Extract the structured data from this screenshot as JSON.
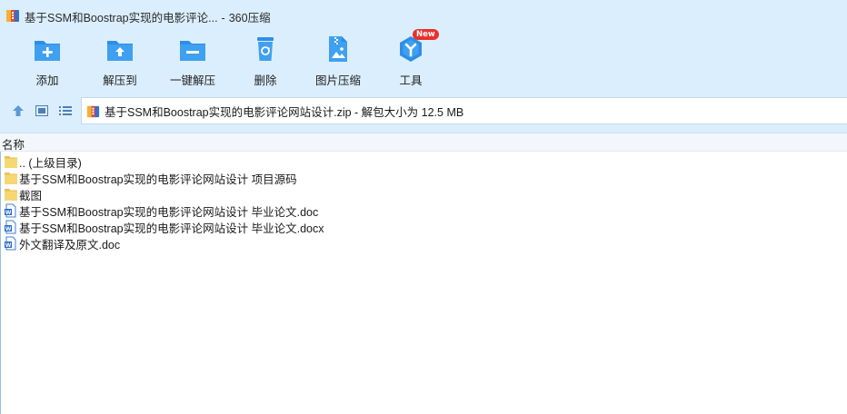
{
  "window": {
    "title": "基于SSM和Boostrap实现的电影评论...",
    "separator": "-",
    "app_name": "360压缩"
  },
  "toolbar": {
    "items": [
      {
        "label": "添加",
        "icon": "add-icon"
      },
      {
        "label": "解压到",
        "icon": "extract-to-icon"
      },
      {
        "label": "一键解压",
        "icon": "one-click-extract-icon"
      },
      {
        "label": "删除",
        "icon": "delete-icon"
      },
      {
        "label": "图片压缩",
        "icon": "image-compress-icon"
      },
      {
        "label": "工具",
        "icon": "tools-icon",
        "badge": "New"
      }
    ]
  },
  "nav": {
    "up_icon": "arrow-up-icon",
    "thumbnail_view_icon": "thumbnail-view-icon",
    "list_view_icon": "list-view-icon",
    "path_text": "基于SSM和Boostrap实现的电影评论网站设计.zip - 解包大小为 12.5 MB"
  },
  "file_list": {
    "column_name": "名称",
    "rows": [
      {
        "name": ".. (上级目录)",
        "icon": "folder-icon"
      },
      {
        "name": "基于SSM和Boostrap实现的电影评论网站设计 项目源码",
        "icon": "folder-icon"
      },
      {
        "name": "截图",
        "icon": "folder-icon"
      },
      {
        "name": "基于SSM和Boostrap实现的电影评论网站设计 毕业论文.doc",
        "icon": "word-doc-icon"
      },
      {
        "name": "基于SSM和Boostrap实现的电影评论网站设计 毕业论文.docx",
        "icon": "word-doc-icon"
      },
      {
        "name": "外文翻译及原文.doc",
        "icon": "word-doc-icon"
      }
    ]
  },
  "colors": {
    "chrome_background": "#dbeefd",
    "icon_blue": "#2e8ee6",
    "folder_yellow": "#f7d774",
    "badge_red": "#e8312c"
  }
}
